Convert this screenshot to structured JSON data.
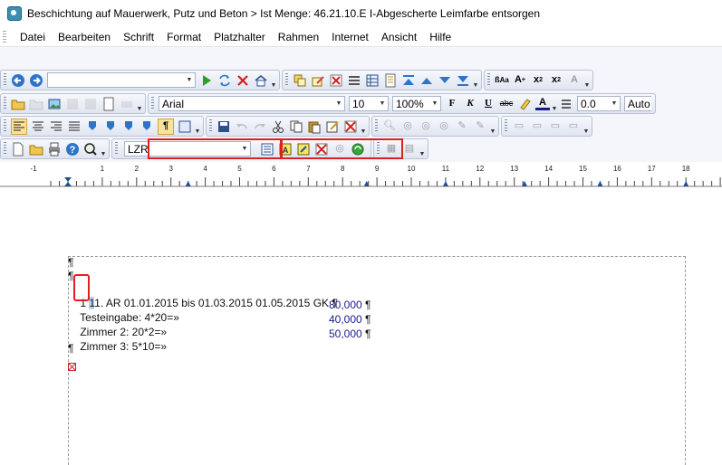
{
  "window": {
    "title": "Beschichtung auf Mauerwerk, Putz und Beton > Ist Menge: 46.21.10.E I-Abgescherte Leimfarbe entsorgen"
  },
  "menu": {
    "items": [
      "Datei",
      "Bearbeiten",
      "Schrift",
      "Format",
      "Platzhalter",
      "Rahmen",
      "Internet",
      "Ansicht",
      "Hilfe"
    ]
  },
  "toolbar": {
    "address_value": "",
    "font_name": "Arial",
    "font_size": "10",
    "zoom": "100%",
    "bold": "F",
    "italic": "K",
    "underline": "U",
    "strike": "abc",
    "spacing": "0.0",
    "auto": "Auto",
    "placeholder_select": "LZR"
  },
  "ruler": {
    "labels": [
      "-1",
      "1",
      "2",
      "3",
      "4",
      "5",
      "6",
      "7",
      "8",
      "9",
      "10",
      "11",
      "12",
      "13",
      "14",
      "15",
      "16",
      "17",
      "18"
    ]
  },
  "document": {
    "pilcrow": "¶",
    "heading_prefix": "1.",
    "heading_selected": "1",
    "heading_text": "1. AR 01.01.2015 bis 01.03.2015 01.05.2015 GK ¶",
    "rows": [
      {
        "label": "Testeingabe: 4*20=»",
        "value": "80,000",
        "mark": "¶"
      },
      {
        "label": "Zimmer 2: 20*2=»",
        "value": "40,000",
        "mark": "¶"
      },
      {
        "label": "Zimmer 3: 5*10=»",
        "value": "50,000",
        "mark": "¶"
      }
    ]
  },
  "colors": {
    "highlight": "#e02020",
    "toolbar_bg": "#f4f6fb",
    "number_text": "#1a1a8a"
  }
}
